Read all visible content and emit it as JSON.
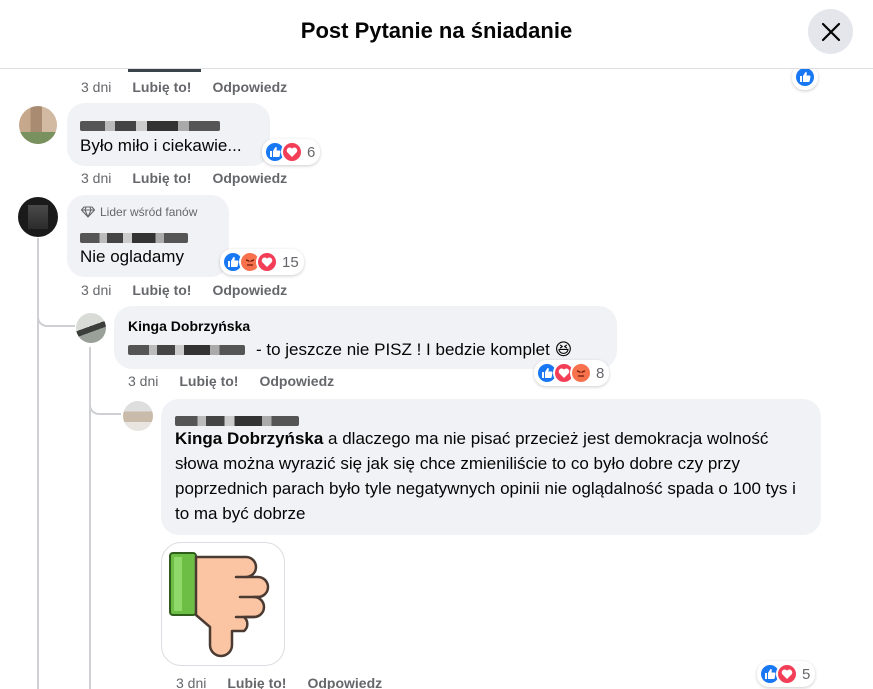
{
  "header": {
    "title": "Post Pytanie na śniadanie"
  },
  "comments": [
    {
      "meta": {
        "time": "3 dni",
        "like": "Lubię to!",
        "reply": "Odpowiedz"
      }
    },
    {
      "text": "Było miło i ciekawie...",
      "reaction_count": "6",
      "meta": {
        "time": "3 dni",
        "like": "Lubię to!",
        "reply": "Odpowiedz"
      }
    },
    {
      "badge": "Lider wśród fanów",
      "text": "Nie ogladamy",
      "reaction_count": "15",
      "meta": {
        "time": "3 dni",
        "like": "Lubię to!",
        "reply": "Odpowiedz"
      }
    },
    {
      "author": "Kinga Dobrzyńska",
      "text": "- to jeszcze nie PISZ ! I bedzie komplet 😆",
      "reaction_count": "8",
      "meta": {
        "time": "3 dni",
        "like": "Lubię to!",
        "reply": "Odpowiedz"
      }
    },
    {
      "mention": "Kinga Dobrzyńska",
      "text": " a dlaczego ma nie pisać przecież jest demokracja wolność słowa można wyrazić się jak się chce zmieniliście to co było dobre czy przy poprzednich parach było tyle negatywnych opinii nie oglądalność spada o 100 tys i to ma być dobrze",
      "reaction_count": "5",
      "meta": {
        "time": "3 dni",
        "like": "Lubię to!",
        "reply": "Odpowiedz"
      }
    }
  ],
  "icons": {
    "close": "close-icon",
    "like": "like-icon",
    "love": "love-icon",
    "angry": "angry-icon",
    "badge": "diamond-icon",
    "sticker": "thumbs-down-icon"
  },
  "colors": {
    "like": "#1877f2",
    "love": "#f33e58",
    "angry": "#f7714c",
    "bubble": "#f0f2f5",
    "meta": "#65676b"
  }
}
